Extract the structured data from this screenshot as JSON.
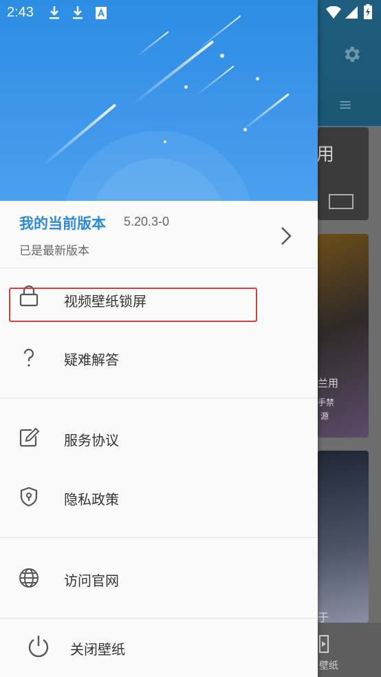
{
  "status_bar": {
    "time": "2:43",
    "icons": [
      "download-icon",
      "download-icon",
      "keyboard-a-icon",
      "wifi-icon",
      "signal-icon",
      "battery-charging-icon"
    ]
  },
  "background_app": {
    "card1_text": "用",
    "card2_text_1": "兰用",
    "card2_text_2": "手禁",
    "card2_text_3": "源",
    "card3_text": "于",
    "nav_label": "壁纸"
  },
  "drawer": {
    "version": {
      "title": "我的当前版本",
      "number": "5.20.3-0",
      "status": "已是最新版本"
    },
    "menu": [
      {
        "label": "视频壁纸锁屏",
        "icon": "lock-icon"
      },
      {
        "label": "疑难解答",
        "icon": "question-icon"
      },
      {
        "label": "服务协议",
        "icon": "edit-document-icon"
      },
      {
        "label": "隐私政策",
        "icon": "shield-icon"
      },
      {
        "label": "访问官网",
        "icon": "globe-icon"
      },
      {
        "label": "关闭壁纸",
        "icon": "power-icon"
      }
    ]
  },
  "colors": {
    "accent": "#2d89d6",
    "highlight_box": "#e23b3b",
    "header_gradient_top": "#2c8de3"
  }
}
